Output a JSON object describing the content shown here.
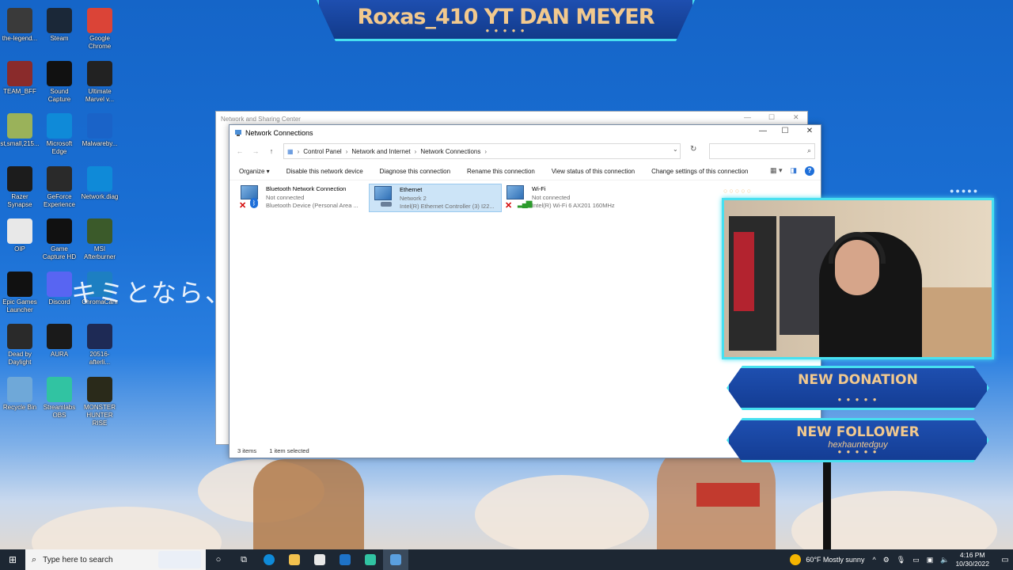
{
  "banner": {
    "title": "Roxas_410 YT DAN MEYER",
    "dots": "● ● ● ● ●"
  },
  "overlay_text": "キミとなら、",
  "desktop_icons": [
    {
      "label": "the-legend...",
      "color": "#3a3a3a"
    },
    {
      "label": "Steam",
      "color": "#1b2838"
    },
    {
      "label": "Google Chrome",
      "color": "#db4437"
    },
    {
      "label": "TEAM_BFF",
      "color": "#8a2b2b"
    },
    {
      "label": "Sound Capture",
      "color": "#111"
    },
    {
      "label": "Ultimate Marvel v...",
      "color": "#222"
    },
    {
      "label": "st,small,215...",
      "color": "#9ab25a"
    },
    {
      "label": "Microsoft Edge",
      "color": "#0f8ad8"
    },
    {
      "label": "Malwareby...",
      "color": "#1a63c8"
    },
    {
      "label": "Razer Synapse",
      "color": "#1c1c1c"
    },
    {
      "label": "GeForce Experience",
      "color": "#2a2a2a"
    },
    {
      "label": "Network.diag",
      "color": "#0f8ad8"
    },
    {
      "label": "OIP",
      "color": "#e8e8e8"
    },
    {
      "label": "Game Capture HD",
      "color": "#111"
    },
    {
      "label": "MSI Afterburner",
      "color": "#3b5a2a"
    },
    {
      "label": "Epic Games Launcher",
      "color": "#111"
    },
    {
      "label": "Discord",
      "color": "#5865f2"
    },
    {
      "label": "ChromaCam",
      "color": "#1d7fc2"
    },
    {
      "label": "Dead by Daylight",
      "color": "#2a2a2a"
    },
    {
      "label": "AURA",
      "color": "#1a1a1a"
    },
    {
      "label": "20516-afterli...",
      "color": "#1e2a55"
    },
    {
      "label": "Recycle Bin",
      "color": "#6fa8d8"
    },
    {
      "label": "Streamlabs OBS",
      "color": "#31c3a2"
    },
    {
      "label": "MONSTER HUNTER RISE",
      "color": "#2a2a1a"
    }
  ],
  "back_window": {
    "title": "Network and Sharing Center"
  },
  "window": {
    "title": "Network Connections",
    "breadcrumb": [
      "Control Panel",
      "Network and Internet",
      "Network Connections"
    ],
    "search_placeholder": "",
    "commands": [
      "Organize ▾",
      "Disable this network device",
      "Diagnose this connection",
      "Rename this connection",
      "View status of this connection",
      "Change settings of this connection"
    ],
    "connections": [
      {
        "name": "Bluetooth Network Connection",
        "status": "Not connected",
        "device": "Bluetooth Device (Personal Area ...",
        "type": "bluetooth",
        "selected": false
      },
      {
        "name": "Ethernet",
        "status": "Network 2",
        "device": "Intel(R) Ethernet Controller (3) I22...",
        "type": "ethernet",
        "selected": true
      },
      {
        "name": "Wi-Fi",
        "status": "Not connected",
        "device": "Intel(R) Wi-Fi 6 AX201 160MHz",
        "type": "wifi",
        "selected": false
      }
    ],
    "status": {
      "items": "3 items",
      "selected": "1 item selected"
    }
  },
  "alerts": [
    {
      "title": "NEW DONATION",
      "sub": ""
    },
    {
      "title": "NEW FOLLOWER",
      "sub": "hexhauntedguy"
    }
  ],
  "alert_dots": "● ● ● ● ●",
  "taskbar": {
    "search_placeholder": "Type here to search",
    "weather": "60°F  Mostly sunny",
    "time": "4:16 PM",
    "date": "10/30/2022"
  }
}
